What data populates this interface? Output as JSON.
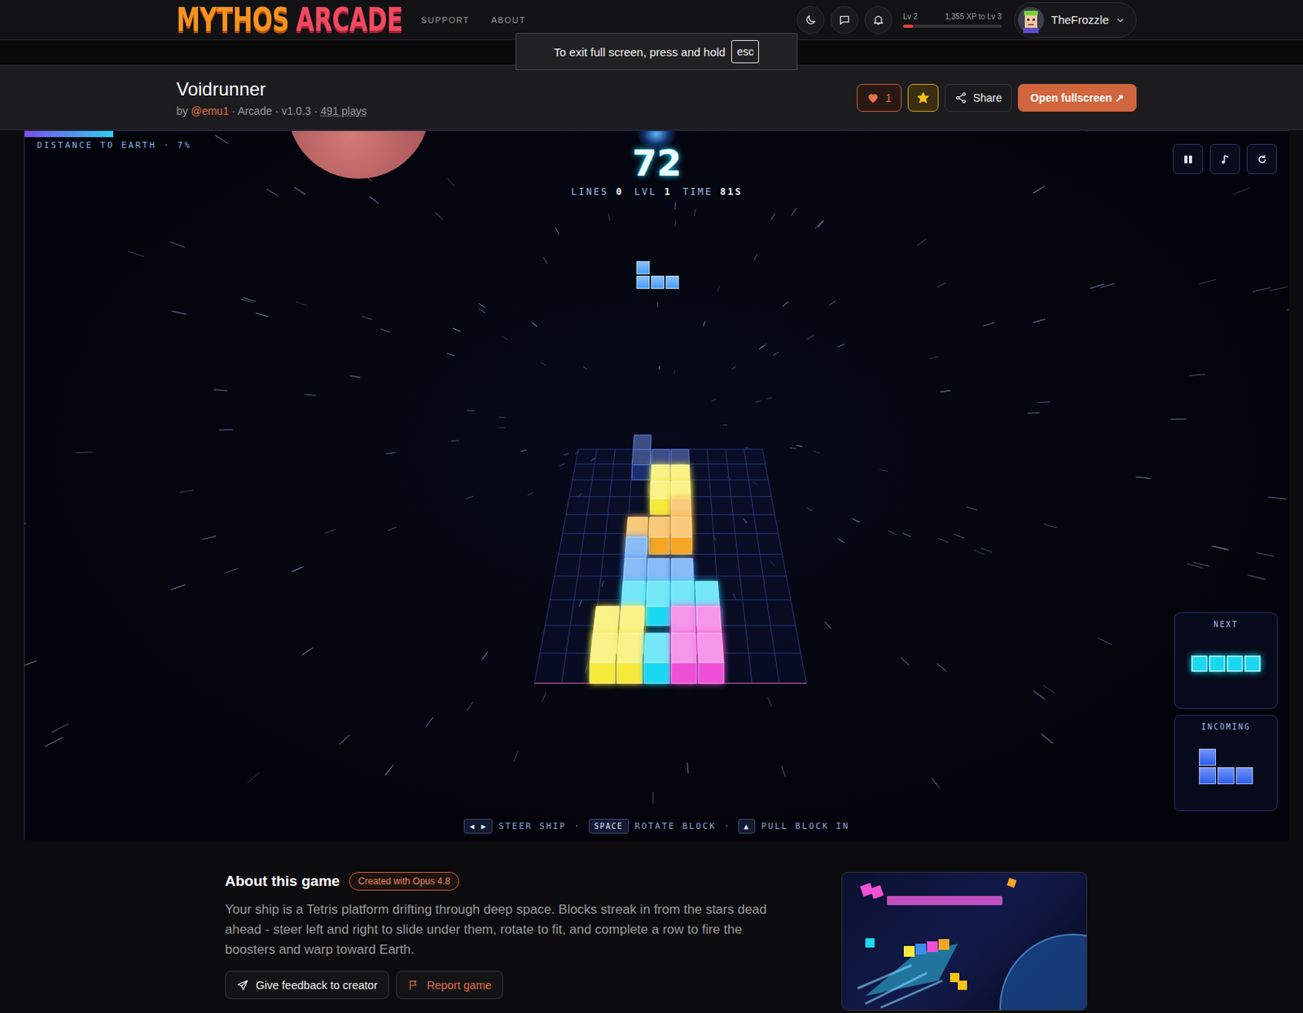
{
  "nav": {
    "logo": [
      "MYTHOS",
      "ARCADE"
    ],
    "links": [
      "SUPPORT",
      "ABOUT"
    ],
    "level": "Lv 2",
    "xp": {
      "text": "1,355 XP to Lv 3",
      "level": 0.1
    },
    "user": "TheFrozzle"
  },
  "toast": {
    "text": "To exit full screen, press and hold",
    "key": "esc"
  },
  "game": {
    "title": "Voidrunner",
    "by": "by",
    "author": "@emu1",
    "meta": [
      "Arcade",
      "v1.0.3"
    ],
    "plays": "491 plays",
    "separator": "·",
    "likes": "1",
    "liked": true,
    "favorited": true,
    "share": "Share",
    "open": "Open fullscreen ↗"
  },
  "hud": {
    "distance": {
      "text": "DISTANCE TO EARTH · 7%",
      "level": 0.07
    },
    "score": "72",
    "stats": [
      {
        "label": "LINES",
        "value": "0"
      },
      {
        "label": "LVL",
        "value": "1"
      },
      {
        "label": "TIME",
        "value": "81S"
      }
    ],
    "falling": {
      "cells": [
        [
          0,
          0
        ],
        [
          1,
          0
        ],
        [
          1,
          1
        ],
        [
          1,
          2
        ]
      ],
      "color": "#4a9ef5"
    },
    "next": {
      "label": "NEXT",
      "cells": [
        [
          0,
          0
        ],
        [
          0,
          1
        ],
        [
          0,
          2
        ],
        [
          0,
          3
        ]
      ],
      "color": "#1ad8f0"
    },
    "incoming": {
      "label": "INCOMING",
      "cells": [
        [
          0,
          0
        ],
        [
          1,
          0
        ],
        [
          1,
          1
        ],
        [
          1,
          2
        ]
      ],
      "color": "#2a5cf0"
    },
    "controls": [
      {
        "key": "◀ ▶",
        "label": "STEER SHIP"
      },
      {
        "key": "SPACE",
        "label": "ROTATE BLOCK"
      },
      {
        "key": "▲",
        "label": "PULL BLOCK IN"
      }
    ],
    "separator": "·",
    "board": {
      "columns": 10,
      "rows": 11,
      "blocks": [
        {
          "row": 0,
          "col": 2,
          "kind": "block",
          "color": "#f5ea3a"
        },
        {
          "row": 0,
          "col": 3,
          "kind": "block",
          "color": "#f5ea3a"
        },
        {
          "row": 0,
          "col": 4,
          "kind": "block",
          "color": "#19d9f2"
        },
        {
          "row": 0,
          "col": 5,
          "kind": "block",
          "color": "#f050d8"
        },
        {
          "row": 0,
          "col": 6,
          "kind": "block",
          "color": "#f050d8"
        },
        {
          "row": 1,
          "col": 2,
          "kind": "block",
          "color": "#f5ea3a"
        },
        {
          "row": 1,
          "col": 3,
          "kind": "block",
          "color": "#f5ea3a"
        },
        {
          "row": 1,
          "col": 5,
          "kind": "block",
          "color": "#f050d8"
        },
        {
          "row": 1,
          "col": 6,
          "kind": "block",
          "color": "#f050d8"
        },
        {
          "row": 2,
          "col": 3,
          "kind": "block",
          "color": "#19d9f2"
        },
        {
          "row": 2,
          "col": 4,
          "kind": "block",
          "color": "#19d9f2"
        },
        {
          "row": 2,
          "col": 5,
          "kind": "block",
          "color": "#19d9f2"
        },
        {
          "row": 2,
          "col": 6,
          "kind": "block",
          "color": "#19d9f2"
        },
        {
          "row": 3,
          "col": 3,
          "kind": "block",
          "color": "#3b8df0"
        },
        {
          "row": 3,
          "col": 4,
          "kind": "block",
          "color": "#3b8df0"
        },
        {
          "row": 3,
          "col": 5,
          "kind": "block",
          "color": "#3b8df0"
        },
        {
          "row": 4,
          "col": 3,
          "kind": "block",
          "color": "#3b8df0"
        },
        {
          "row": 5,
          "col": 3,
          "kind": "block",
          "color": "#f5a623"
        },
        {
          "row": 5,
          "col": 4,
          "kind": "block",
          "color": "#f5a623"
        },
        {
          "row": 5,
          "col": 5,
          "kind": "block",
          "color": "#f5a623"
        },
        {
          "row": 6,
          "col": 5,
          "kind": "block",
          "color": "#f5a623"
        },
        {
          "row": 7,
          "col": 4,
          "kind": "block",
          "color": "#f5ea3a"
        },
        {
          "row": 7,
          "col": 5,
          "kind": "block",
          "color": "#f5ea3a"
        },
        {
          "row": 8,
          "col": 4,
          "kind": "block",
          "color": "#f5ea3a"
        },
        {
          "row": 8,
          "col": 5,
          "kind": "block",
          "color": "#f5ea3a"
        },
        {
          "row": 9,
          "col": 3,
          "kind": "ghost",
          "color": "#1b2f6e"
        },
        {
          "row": 9,
          "col": 4,
          "kind": "ghost",
          "color": "#1b2f6e"
        },
        {
          "row": 9,
          "col": 5,
          "kind": "ghost",
          "color": "#1b2f6e"
        },
        {
          "row": 10,
          "col": 3,
          "kind": "ghost",
          "color": "#1b2f6e"
        }
      ]
    }
  },
  "about": {
    "heading": "About this game",
    "badge": "Created with Opus 4.8",
    "description": "Your ship is a Tetris platform drifting through deep space. Blocks streak in from the stars dead ahead - steer left and right to slide under them, rotate to fit, and complete a row to fire the boosters and warp toward Earth.",
    "buttons": [
      "Give feedback to creator",
      "Report game"
    ]
  }
}
